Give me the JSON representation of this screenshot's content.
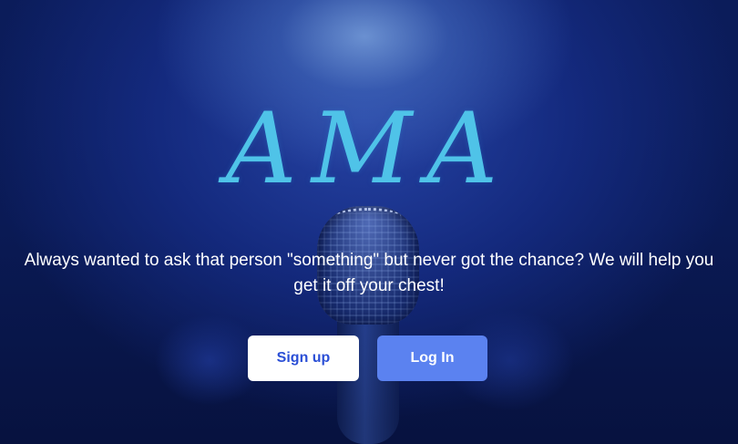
{
  "hero": {
    "title": "AMA",
    "tagline": "Always wanted to ask that person \"something\" but never got the chance? We will help you get it off your chest!",
    "background_image": "microphone-on-stage"
  },
  "actions": {
    "signup_label": "Sign up",
    "login_label": "Log In"
  },
  "colors": {
    "title": "#4fc3e8",
    "signup_text": "#2b4fd6",
    "login_bg": "#5b82f0",
    "background": "#0a1a55"
  }
}
